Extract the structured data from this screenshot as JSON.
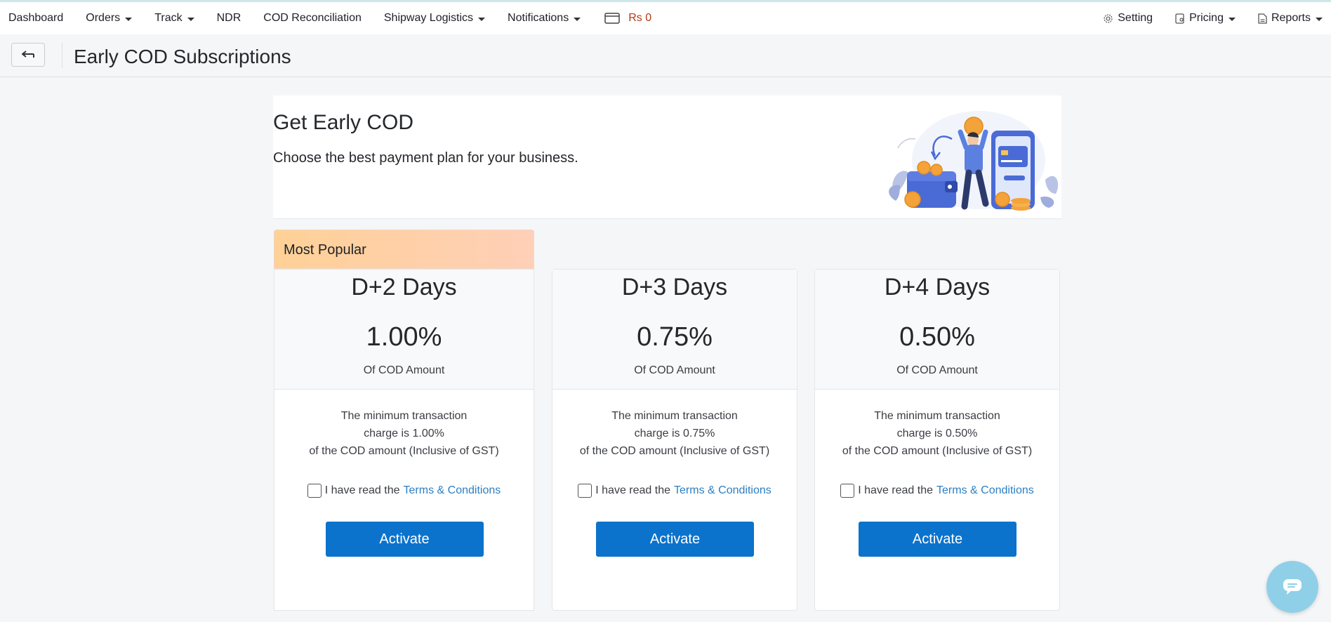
{
  "navbar": {
    "left_items": [
      {
        "label": "Dashboard",
        "dropdown": false
      },
      {
        "label": "Orders",
        "dropdown": true
      },
      {
        "label": "Track",
        "dropdown": true
      },
      {
        "label": "NDR",
        "dropdown": false
      },
      {
        "label": "COD Reconciliation",
        "dropdown": false
      },
      {
        "label": "Shipway Logistics",
        "dropdown": true
      },
      {
        "label": "Notifications",
        "dropdown": true
      }
    ],
    "wallet": {
      "icon": "wallet-icon",
      "amount": "Rs 0"
    },
    "right_items": [
      {
        "label": "Setting",
        "icon": "gear-icon",
        "dropdown": false
      },
      {
        "label": "Pricing",
        "icon": "tag-icon",
        "dropdown": true
      },
      {
        "label": "Reports",
        "icon": "document-icon",
        "dropdown": true
      }
    ]
  },
  "header": {
    "back_icon": "back-arrow-icon",
    "title": "Early COD Subscriptions"
  },
  "hero": {
    "title": "Get Early COD",
    "subtitle": "Choose the best payment plan for your business."
  },
  "plans": [
    {
      "badge": "Most Popular",
      "name": "D+2 Days",
      "rate": "1.00%",
      "unit": "Of COD Amount",
      "desc_line1": "The minimum transaction",
      "desc_line2": "charge is 1.00%",
      "desc_line3": "of the COD amount (Inclusive of GST)",
      "terms_text": "I have read the",
      "terms_link": "Terms & Conditions",
      "button": "Activate"
    },
    {
      "name": "D+3 Days",
      "rate": "0.75%",
      "unit": "Of COD Amount",
      "desc_line1": "The minimum transaction",
      "desc_line2": "charge is 0.75%",
      "desc_line3": "of the COD amount (Inclusive of GST)",
      "terms_text": "I have read the",
      "terms_link": "Terms & Conditions",
      "button": "Activate"
    },
    {
      "name": "D+4 Days",
      "rate": "0.50%",
      "unit": "Of COD Amount",
      "desc_line1": "The minimum transaction",
      "desc_line2": "charge is 0.50%",
      "desc_line3": "of the COD amount (Inclusive of GST)",
      "terms_text": "I have read the",
      "terms_link": "Terms & Conditions",
      "button": "Activate"
    }
  ],
  "chat": {
    "icon": "chat-icon"
  },
  "colors": {
    "primary_button": "#0b73cc",
    "link": "#2d7fc2",
    "wallet_amount": "#b03a13",
    "popular_gradient_start": "#ffd196",
    "popular_gradient_end": "#ffcfb8",
    "chat_bubble": "#8fd0e8"
  }
}
